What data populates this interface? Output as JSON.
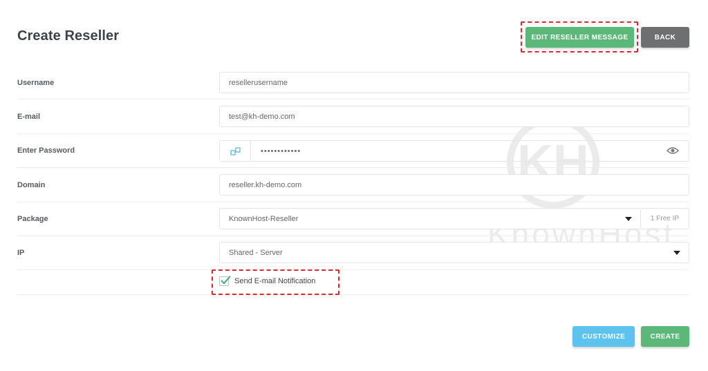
{
  "page": {
    "title": "Create Reseller"
  },
  "toolbar": {
    "edit_message_label": "EDIT RESELLER MESSAGE",
    "back_label": "BACK"
  },
  "form": {
    "username": {
      "label": "Username",
      "value": "resellerusername"
    },
    "email": {
      "label": "E-mail",
      "value": "test@kh-demo.com"
    },
    "password": {
      "label": "Enter Password",
      "value": "••••••••••••"
    },
    "domain": {
      "label": "Domain",
      "value": "reseller.kh-demo.com"
    },
    "package": {
      "label": "Package",
      "value": "KnownHost-Reseller",
      "suffix": "1 Free IP"
    },
    "ip": {
      "label": "IP",
      "value": "Shared - Server"
    },
    "notify": {
      "label": "Send E-mail Notification",
      "checked": true
    }
  },
  "footer": {
    "customize_label": "CUSTOMIZE",
    "create_label": "CREATE"
  },
  "watermark": {
    "brand": "KnownHost",
    "logo_letters": "KH"
  },
  "colors": {
    "green": "#5cb878",
    "gray": "#6d6f70",
    "blue": "#5cc2ee",
    "highlight": "#e0262b",
    "check": "#4caf7a"
  }
}
